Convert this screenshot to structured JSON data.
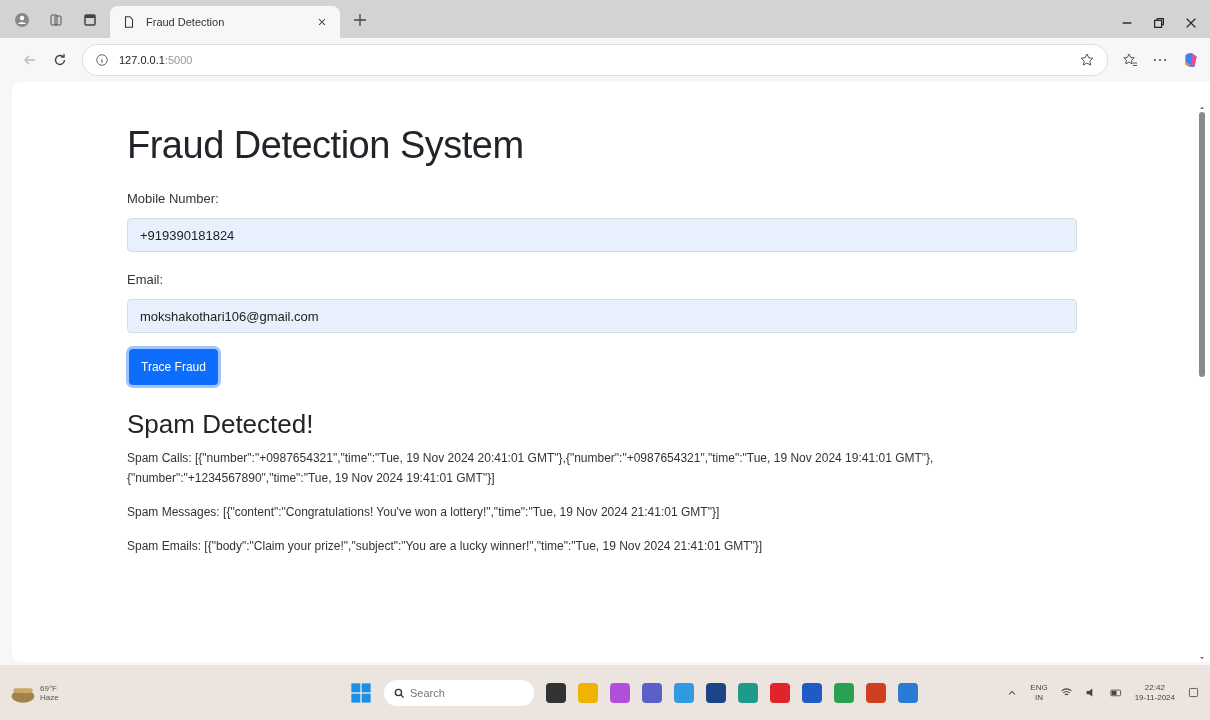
{
  "browser": {
    "tab": {
      "title": "Fraud Detection",
      "selected": true
    },
    "address": {
      "host": "127.0.0.1",
      "port": ":5000"
    }
  },
  "page": {
    "title": "Fraud Detection System",
    "fields": [
      {
        "label": "Mobile Number:",
        "value": "+919390181824"
      },
      {
        "label": "Email:",
        "value": "mokshakothari106@gmail.com"
      }
    ],
    "button": "Trace Fraud",
    "result": {
      "heading": "Spam Detected!",
      "lines": [
        "Spam Calls: [{\"number\":\"+0987654321\",\"time\":\"Tue, 19 Nov 2024 20:41:01 GMT\"},{\"number\":\"+0987654321\",\"time\":\"Tue, 19 Nov 2024 19:41:01 GMT\"},{\"number\":\"+1234567890\",\"time\":\"Tue, 19 Nov 2024 19:41:01 GMT\"}]",
        "Spam Messages: [{\"content\":\"Congratulations! You've won a lottery!\",\"time\":\"Tue, 19 Nov 2024 21:41:01 GMT\"}]",
        "Spam Emails: [{\"body\":\"Claim your prize!\",\"subject\":\"You are a lucky winner!\",\"time\":\"Tue, 19 Nov 2024 21:41:01 GMT\"}]"
      ]
    }
  },
  "taskbar": {
    "weather": {
      "temp": "69°F",
      "condition": "Haze"
    },
    "search": {
      "placeholder": "Search"
    },
    "tray": {
      "lang": "ENG",
      "region": "IN",
      "time": "22:42",
      "date": "19-11-2024"
    }
  }
}
